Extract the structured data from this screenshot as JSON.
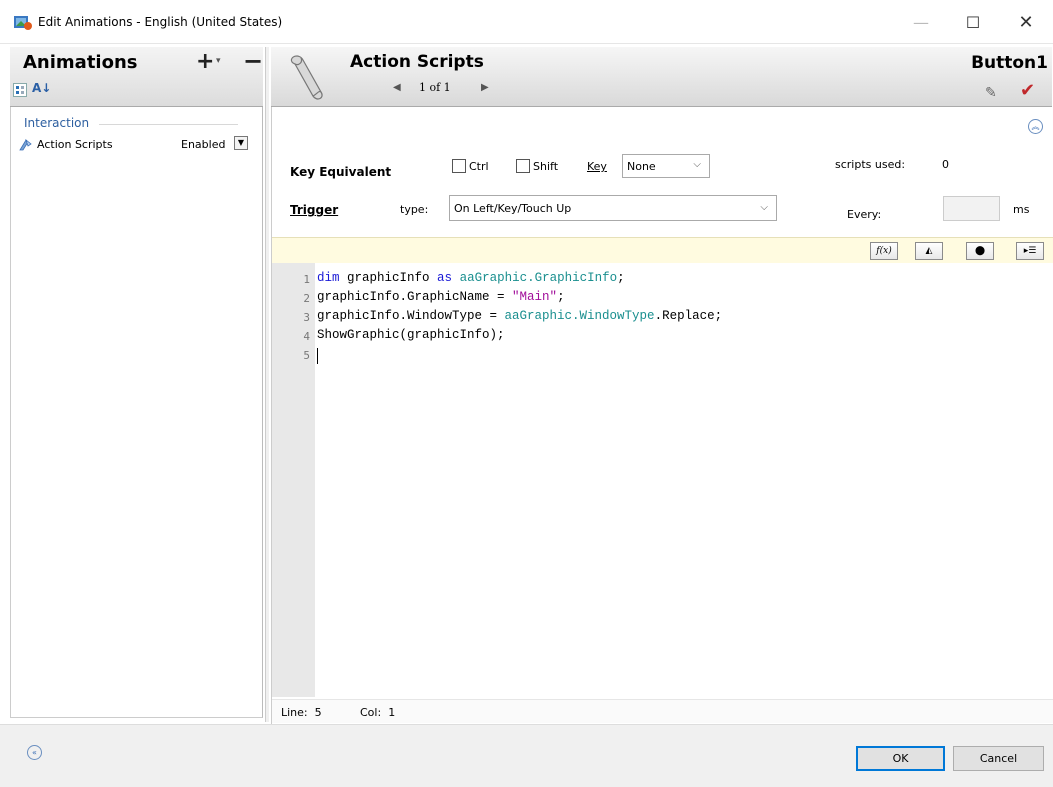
{
  "window": {
    "title": "Edit Animations - English (United States)",
    "controls": {
      "minimize": "—",
      "maximize": "☐",
      "close": "✕"
    }
  },
  "left_panel": {
    "title": "Animations",
    "add_symbol": "+",
    "add_dropdown": "▾",
    "remove_symbol": "−",
    "sort_symbol": "A↓",
    "section": "Interaction",
    "items": [
      {
        "label": "Action Scripts",
        "state": "Enabled",
        "dropdown": "▼",
        "icon": "action-script-icon"
      }
    ]
  },
  "right_header": {
    "title": "Action Scripts",
    "prev": "◀",
    "page": "1 of 1",
    "next": "▶",
    "object_name": "Button1",
    "eraser": "✎",
    "check": "✔"
  },
  "form": {
    "collapse": "︽",
    "key_equivalent_label": "Key Equivalent",
    "ctrl_label": "Ctrl",
    "ctrl_checked": false,
    "shift_label": "Shift",
    "shift_checked": false,
    "key_label": "Key",
    "key_value": "None",
    "dropdown_arrow": "⌵",
    "scripts_used_label": "scripts used:",
    "scripts_used_value": "0",
    "trigger_label": "Trigger",
    "type_label": "type:",
    "trigger_value": "On Left/Key/Touch Up",
    "every_label": "Every:",
    "every_value": "",
    "ms_label": "ms"
  },
  "toolbar": {
    "function_btn": "f(x)",
    "graphic_btn": "◭",
    "browser_btn": "⬤",
    "display_btn": "▸☰"
  },
  "editor": {
    "line_numbers": [
      "1",
      "2",
      "3",
      "4",
      "5"
    ],
    "lines": [
      [
        {
          "t": "dim",
          "c": "kw"
        },
        {
          "t": " graphicInfo ",
          "c": ""
        },
        {
          "t": "as",
          "c": "kw"
        },
        {
          "t": " ",
          "c": ""
        },
        {
          "t": "aaGraphic.GraphicInfo",
          "c": "ty"
        },
        {
          "t": ";",
          "c": ""
        }
      ],
      [
        {
          "t": "graphicInfo.GraphicName = ",
          "c": ""
        },
        {
          "t": "\"Main\"",
          "c": "str"
        },
        {
          "t": ";",
          "c": ""
        }
      ],
      [
        {
          "t": "graphicInfo.WindowType = ",
          "c": ""
        },
        {
          "t": "aaGraphic.WindowType",
          "c": "ty"
        },
        {
          "t": ".Replace;",
          "c": ""
        }
      ],
      [
        {
          "t": "ShowGraphic(graphicInfo);",
          "c": ""
        }
      ],
      []
    ]
  },
  "status": {
    "line_label": "Line:",
    "line_value": "5",
    "col_label": "Col:",
    "col_value": "1"
  },
  "footer": {
    "expand": "«",
    "ok": "OK",
    "cancel": "Cancel"
  }
}
